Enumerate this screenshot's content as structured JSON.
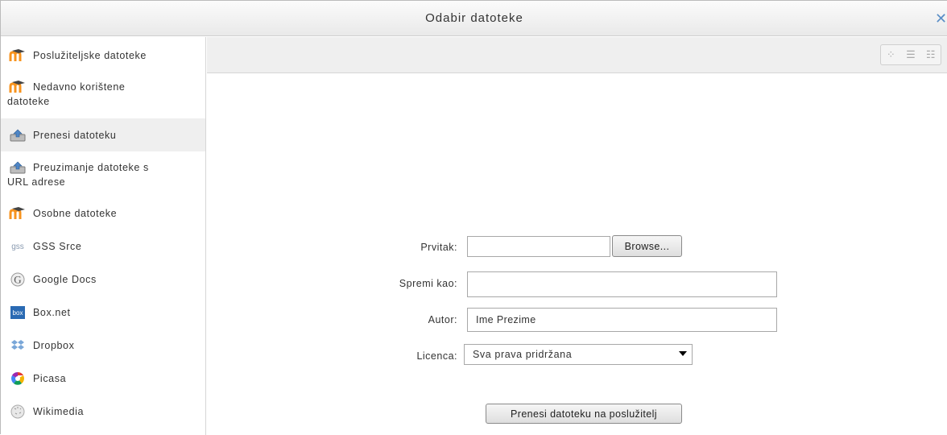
{
  "dialog": {
    "title": "Odabir datoteke",
    "close_icon": "close-icon"
  },
  "sidebar": {
    "items": [
      {
        "label": "Poslužiteljske datoteke",
        "icon": "moodle-icon"
      },
      {
        "label": "Nedavno korištene",
        "label2": "datoteke",
        "icon": "moodle-icon"
      },
      {
        "label": "Prenesi datoteku",
        "icon": "upload-icon",
        "active": true
      },
      {
        "label": "Preuzimanje datoteke s",
        "label2": "URL adrese",
        "icon": "upload-icon"
      },
      {
        "label": "Osobne datoteke",
        "icon": "moodle-icon"
      },
      {
        "label": "GSS Srce",
        "icon": "gss-icon"
      },
      {
        "label": "Google Docs",
        "icon": "google-icon"
      },
      {
        "label": "Box.net",
        "icon": "box-icon"
      },
      {
        "label": "Dropbox",
        "icon": "dropbox-icon"
      },
      {
        "label": "Picasa",
        "icon": "picasa-icon"
      },
      {
        "label": "Wikimedia",
        "icon": "wikimedia-icon"
      }
    ]
  },
  "toolbar": {
    "views": [
      "icons-view",
      "list-view",
      "tree-view"
    ]
  },
  "form": {
    "attachment_label": "Prvitak:",
    "browse_label": "Browse...",
    "saveas_label": "Spremi kao:",
    "saveas_value": "",
    "author_label": "Autor:",
    "author_value": "Ime Prezime",
    "license_label": "Licenca:",
    "license_value": "Sva prava pridržana",
    "upload_button": "Prenesi datoteku na poslužitelj"
  },
  "colors": {
    "accent": "#5a8ec7",
    "moodle_orange": "#f7931e"
  }
}
